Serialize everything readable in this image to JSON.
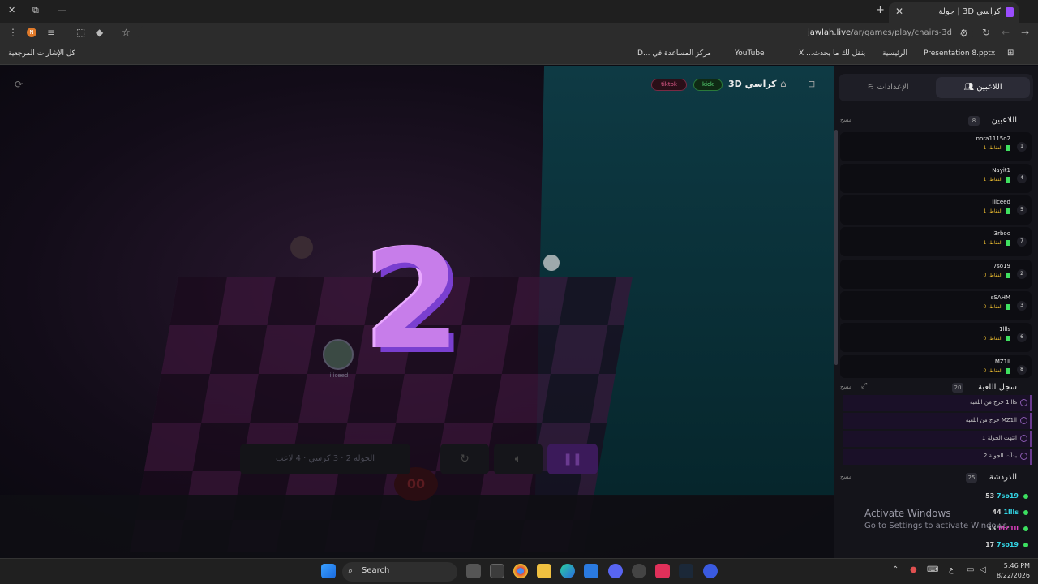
{
  "browser": {
    "tab_title": "كراسي 3D | جولة",
    "url_host": "jawlah.live",
    "url_path": "/ar/games/play/chairs-3d",
    "bookmarks": [
      {
        "label": "Presentation 8.pptx"
      },
      {
        "label": "الرئيسية"
      },
      {
        "label": "ينقل لك ما يحدث... X"
      },
      {
        "label": "YouTube"
      },
      {
        "label": "مركز المساعدة في ...D"
      },
      {
        "label": "كل الإشارات المرجعية"
      }
    ],
    "profile_initial": "N"
  },
  "game": {
    "title": "كراسي 3D",
    "kick_label": "kick",
    "tiktok_label": "tiktok",
    "countdown": "2",
    "timer": "00",
    "round_info": "الجولة 2 · 3 كرسي · 4 لاعب",
    "avatar_name": "iiiceed"
  },
  "panel": {
    "tab_players": "اللاعبين",
    "tab_settings": "الإعدادات",
    "players_header": "اللاعبين",
    "players_count": "8",
    "clear_label": "مسح",
    "players": [
      {
        "name": "nora1115o2",
        "points": "النقاط: 1",
        "rank": "1"
      },
      {
        "name": "Nayit1",
        "points": "النقاط: 1",
        "rank": "4"
      },
      {
        "name": "iiiceed",
        "points": "النقاط: 1",
        "rank": "5"
      },
      {
        "name": "i3rboo",
        "points": "النقاط: 1",
        "rank": "7"
      },
      {
        "name": "7so19",
        "points": "النقاط: 0",
        "rank": "2"
      },
      {
        "name": "sSAHM",
        "points": "النقاط: 0",
        "rank": "3"
      },
      {
        "name": "1llls",
        "points": "النقاط: 0",
        "rank": "6"
      },
      {
        "name": "MZ1ll",
        "points": "النقاط: 0",
        "rank": "8"
      }
    ],
    "platform": "Kick",
    "log_header": "سجل اللعبة",
    "log_count": "20",
    "log": [
      {
        "text": "1llls خرج من اللعبة"
      },
      {
        "text": "MZ1ll خرج من اللعبة"
      },
      {
        "text": "انتهت الجولة 1"
      },
      {
        "text": "بدأت الجولة 2"
      }
    ],
    "chat_header": "الدردشة",
    "chat_count": "25",
    "chat": [
      {
        "name": "7so19",
        "value": "53",
        "color": "#33d6e6"
      },
      {
        "name": "1llls",
        "value": "44",
        "color": "#33d6e6"
      },
      {
        "name": "MZ1ll",
        "value": "33",
        "color": "#e040c0"
      },
      {
        "name": "7so19",
        "value": "17",
        "color": "#33d6e6"
      }
    ]
  },
  "windows": {
    "activate_title": "Activate Windows",
    "activate_sub": "Go to Settings to activate Windows.",
    "search_label": "Search",
    "time": "5:46 PM",
    "date": "8/22/2026",
    "lang": "ع"
  }
}
